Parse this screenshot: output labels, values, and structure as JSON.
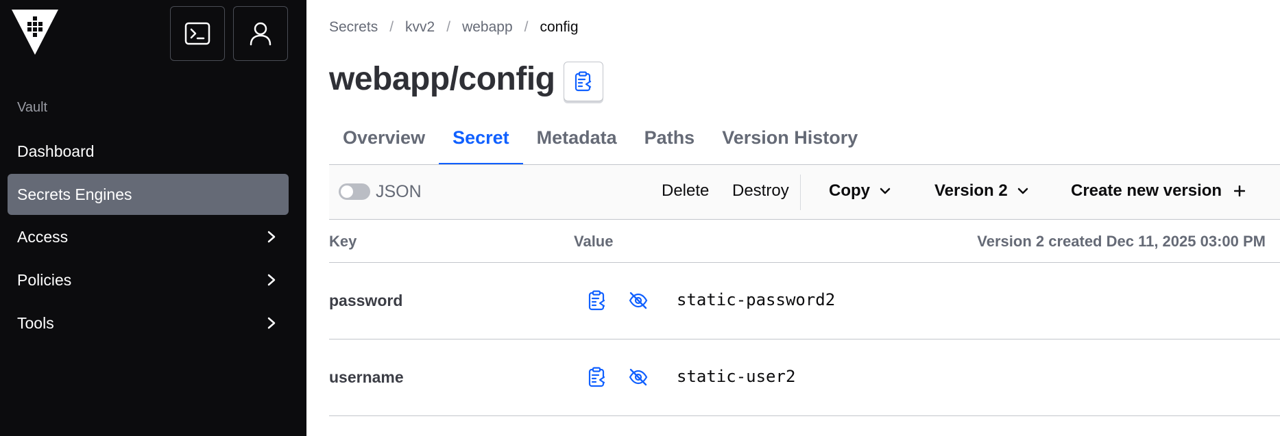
{
  "sidebar": {
    "section_label": "Vault",
    "items": [
      {
        "label": "Dashboard",
        "active": false,
        "has_chevron": false
      },
      {
        "label": "Secrets Engines",
        "active": true,
        "has_chevron": false
      },
      {
        "label": "Access",
        "active": false,
        "has_chevron": true
      },
      {
        "label": "Policies",
        "active": false,
        "has_chevron": true
      },
      {
        "label": "Tools",
        "active": false,
        "has_chevron": true
      }
    ],
    "icons": {
      "logo": "vault-logo-icon",
      "console": "terminal-icon",
      "user": "user-icon"
    }
  },
  "breadcrumb": [
    "Secrets",
    "kvv2",
    "webapp",
    "config"
  ],
  "page_title": "webapp/config",
  "tabs": [
    {
      "label": "Overview",
      "active": false
    },
    {
      "label": "Secret",
      "active": true
    },
    {
      "label": "Metadata",
      "active": false
    },
    {
      "label": "Paths",
      "active": false
    },
    {
      "label": "Version History",
      "active": false
    }
  ],
  "toolbar": {
    "json_toggle_label": "JSON",
    "json_toggle_on": false,
    "delete_label": "Delete",
    "destroy_label": "Destroy",
    "copy_label": "Copy",
    "version_label": "Version 2",
    "create_label": "Create new version"
  },
  "table": {
    "headers": {
      "key": "Key",
      "value": "Value",
      "version_info": "Version 2 created Dec 11, 2025 03:00 PM"
    },
    "rows": [
      {
        "key": "password",
        "value": "static-password2"
      },
      {
        "key": "username",
        "value": "static-user2"
      }
    ]
  },
  "colors": {
    "accent": "#1060ff",
    "sidebar_bg": "#0c0c0e",
    "active_nav": "#656a76"
  }
}
